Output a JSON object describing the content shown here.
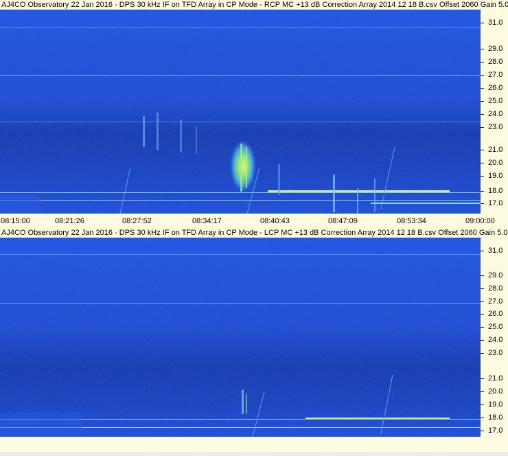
{
  "panels": [
    {
      "id": "rcp",
      "title": "AJ4CO Observatory 22 Jan 2016 - DPS 30 kHz IF on TFD Array in CP Mode - RCP  MC +13 dB  Correction Array 2014 12 18 B.csv  Offset 2060  Gain 5.0"
    },
    {
      "id": "lcp",
      "title": "AJ4CO Observatory 22 Jan 2016 - DPS 30 kHz IF on TFD Array in CP Mode - LCP  MC +13 dB  Correction Array 2014 12 18 B.csv  Offset 2060  Gain 5.0"
    }
  ],
  "freq_labels": [
    "31.0",
    "29.0",
    "28.0",
    "27.0",
    "26.0",
    "25.0",
    "24.0",
    "23.0",
    "21.0",
    "20.0",
    "19.0",
    "18.0",
    "17.0"
  ],
  "time_labels": [
    "08:15:00",
    "08:21:26",
    "08:27:52",
    "08:34:17",
    "08:40:43",
    "08:47:09",
    "08:53:34",
    "09:00:00"
  ],
  "colors": {
    "background": "#fffbe0",
    "spectrogram_base": "#1a3fd0",
    "spectrogram_dark": "#0d1f8c",
    "burst": "#f0f060"
  }
}
